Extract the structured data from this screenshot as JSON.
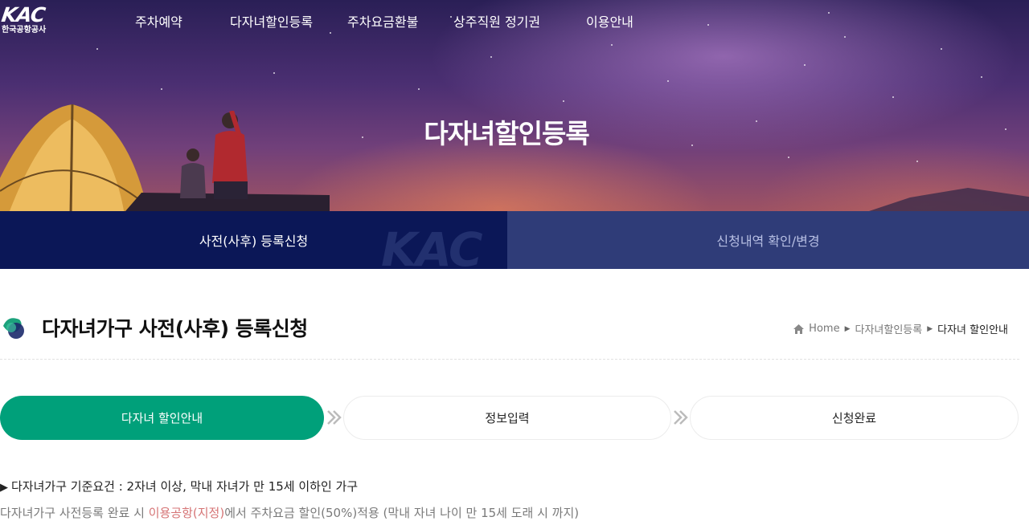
{
  "header": {
    "logo_text": "KAC",
    "logo_sub": "한국공항공사",
    "nav": [
      "주차예약",
      "다자녀할인등록",
      "주차요금환불",
      "상주직원 정기권",
      "이용안내"
    ]
  },
  "hero": {
    "title": "다자녀할인등록"
  },
  "tabs": {
    "watermark": "KAC",
    "items": [
      {
        "label": "사전(사후) 등록신청",
        "active": true
      },
      {
        "label": "신청내역 확인/변경",
        "active": false
      }
    ]
  },
  "page": {
    "title": "다자녀가구 사전(사후) 등록신청"
  },
  "breadcrumb": {
    "home": "Home",
    "level1": "다자녀할인등록",
    "current": "다자녀 할인안내"
  },
  "steps": [
    {
      "label": "다자녀 할인안내",
      "active": true
    },
    {
      "label": "정보입력",
      "active": false
    },
    {
      "label": "신청완료",
      "active": false
    }
  ],
  "info": {
    "criteria": "다자녀가구 기준요건 : 2자녀 이상, 막내 자녀가 만 15세 이하인 가구",
    "line2_prefix": "다자녀가구 사전등록 완료 시 ",
    "line2_highlight": "이용공항(지정)",
    "line2_suffix": "에서 주차요금 할인(50%)적용 (막내 자녀 나이 만 15세 도래 시 까지)"
  },
  "colors": {
    "tab_active": "#0b1757",
    "tab_inactive": "#2f3c78",
    "step_active": "#00a07a"
  }
}
